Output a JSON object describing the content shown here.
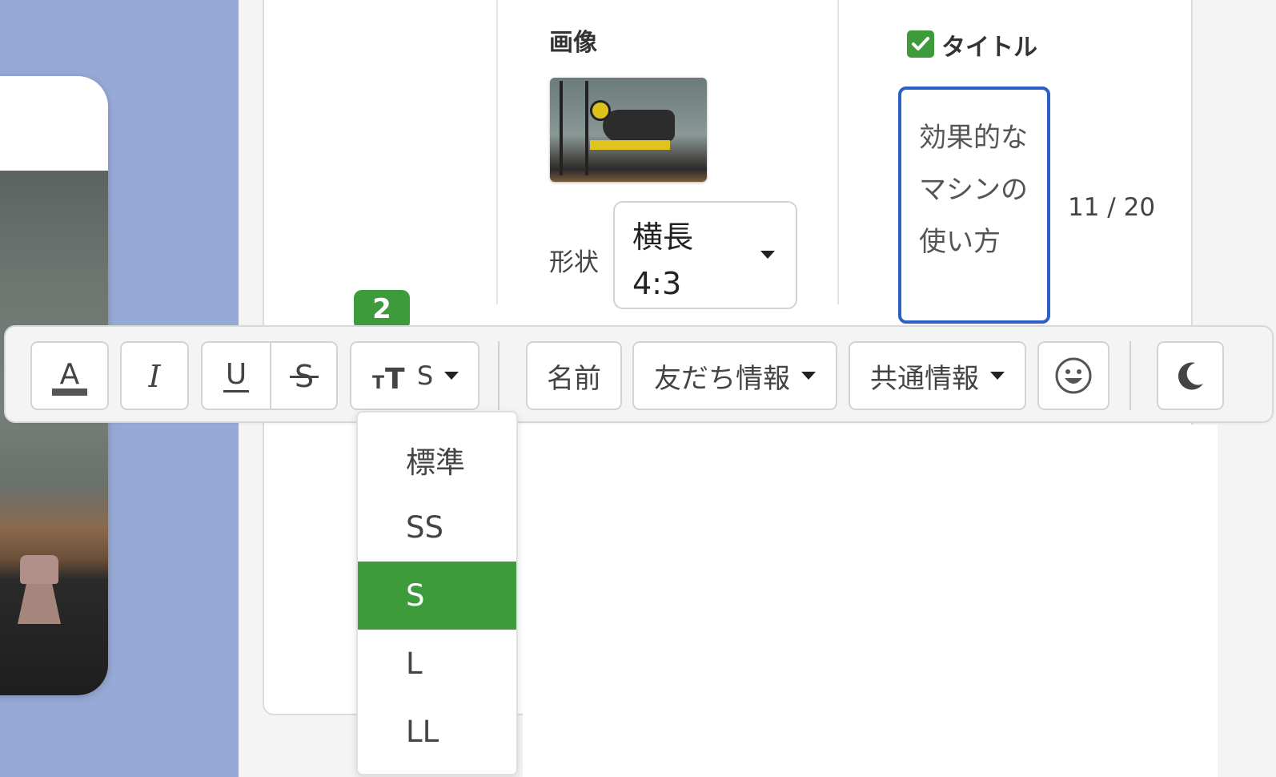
{
  "image_section": {
    "label": "画像",
    "shape_label": "形状",
    "shape_value": "横長\n4:3"
  },
  "title_section": {
    "label": "タイトル",
    "checked": true,
    "value": "効果的なマシンの使い方",
    "counter": "11 / 20"
  },
  "step_number": "2",
  "toolbar": {
    "font_size_value": "S",
    "name_button": "名前",
    "friend_info_button": "友だち情報",
    "common_info_button": "共通情報"
  },
  "font_size_menu": {
    "items": [
      "標準",
      "SS",
      "S",
      "L",
      "LL"
    ],
    "selected": "S"
  },
  "colors": {
    "accent_green": "#3e9b3c",
    "focus_blue": "#2d5fc9",
    "preview_background": "#97a9d6"
  }
}
